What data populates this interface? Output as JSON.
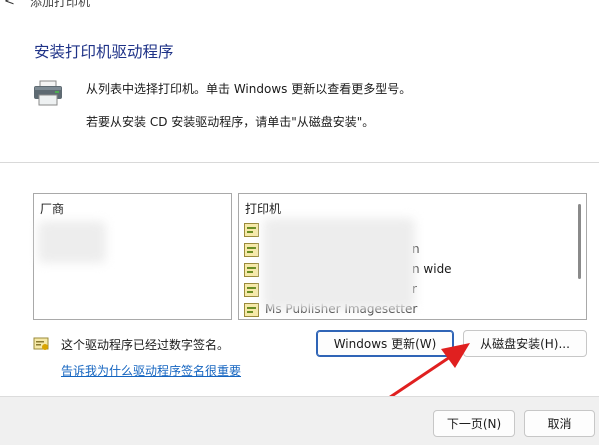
{
  "window": {
    "back_glyph": "<",
    "title": "添加打印机"
  },
  "dialog": {
    "heading": "安装打印机驱动程序",
    "intro_line1": "从列表中选择打印机。单击 Windows 更新以查看更多型号。",
    "intro_line2": "若要从安装 CD 安装驱动程序，请单击\"从磁盘安装\"。"
  },
  "manufacturer_list": {
    "header": "厂商",
    "items": []
  },
  "printer_list": {
    "header": "打印机",
    "rows": [
      {
        "text": "",
        "suffix": ""
      },
      {
        "text": "",
        "suffix": "n"
      },
      {
        "text": "",
        "suffix": "n wide"
      },
      {
        "text": "",
        "suffix": "r"
      },
      {
        "text": "Ms Publisher Imagesetter",
        "suffix": ""
      }
    ]
  },
  "signature": {
    "signed_text": "这个驱动程序已经过数字签名。",
    "why_link": "告诉我为什么驱动程序签名很重要"
  },
  "buttons": {
    "windows_update": "Windows 更新(W)",
    "have_disk": "从磁盘安装(H)...",
    "next": "下一页(N)",
    "cancel": "取消"
  },
  "colors": {
    "heading": "#1e3287",
    "link": "#1565c0",
    "focused_button_border": "#2f64b6",
    "annotation_arrow": "#e02020"
  },
  "icons": [
    "printer-icon",
    "certificate-icon",
    "driver-icon"
  ]
}
